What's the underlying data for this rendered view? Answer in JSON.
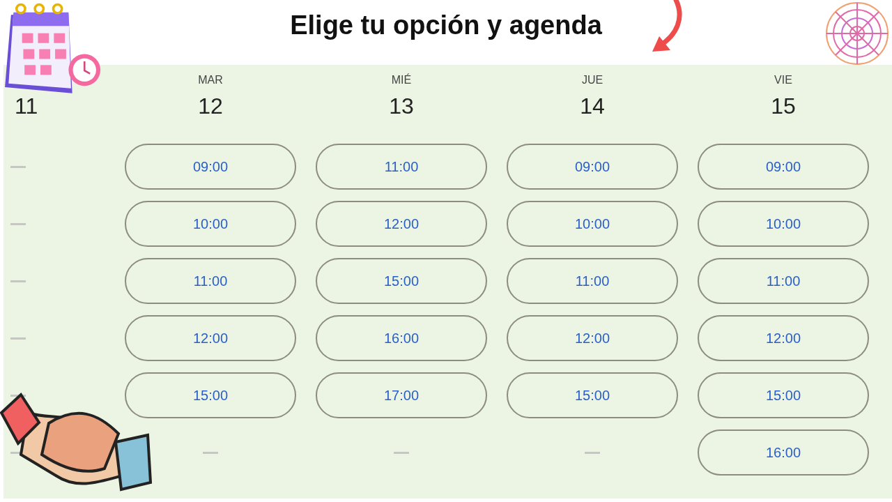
{
  "title": "Elige tu opción y agenda",
  "previous_day": {
    "date": "11"
  },
  "days": [
    {
      "weekday": "MAR",
      "date": "12",
      "slots": [
        "09:00",
        "10:00",
        "11:00",
        "12:00",
        "15:00"
      ]
    },
    {
      "weekday": "MIÉ",
      "date": "13",
      "slots": [
        "11:00",
        "12:00",
        "15:00",
        "16:00",
        "17:00"
      ]
    },
    {
      "weekday": "JUE",
      "date": "14",
      "slots": [
        "09:00",
        "10:00",
        "11:00",
        "12:00",
        "15:00"
      ]
    },
    {
      "weekday": "VIE",
      "date": "15",
      "slots": [
        "09:00",
        "10:00",
        "11:00",
        "12:00",
        "15:00",
        "16:00"
      ]
    }
  ]
}
